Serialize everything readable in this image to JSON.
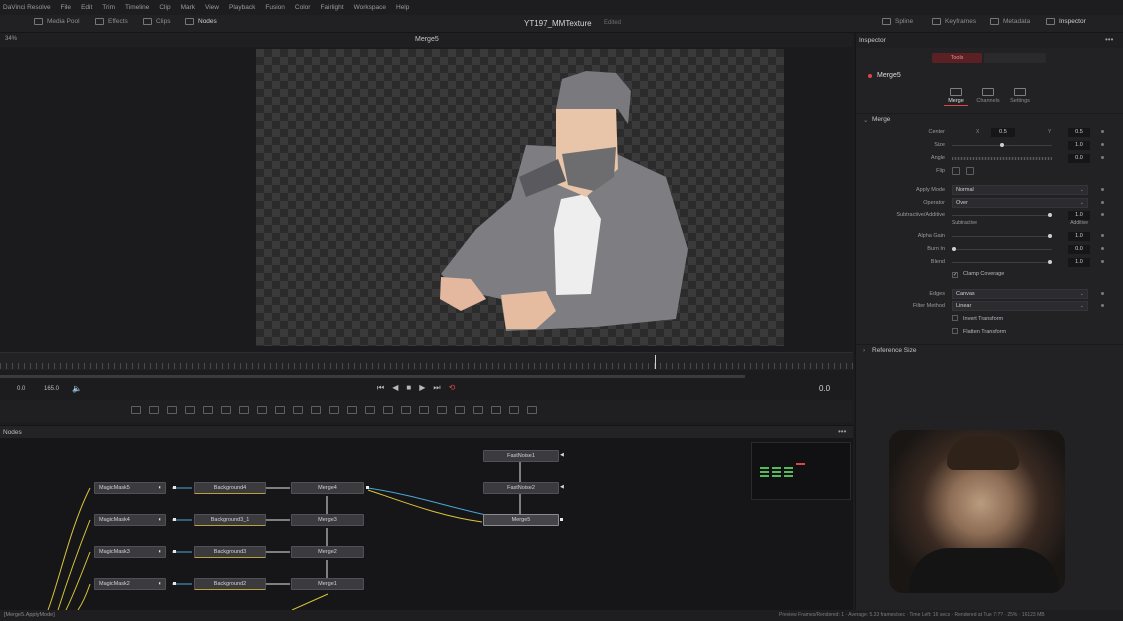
{
  "menu": [
    "DaVinci Resolve",
    "File",
    "Edit",
    "Trim",
    "Timeline",
    "Clip",
    "Mark",
    "View",
    "Playback",
    "Fusion",
    "Color",
    "Fairlight",
    "Workspace",
    "Help"
  ],
  "toolbar": {
    "media_pool": "Media Pool",
    "effects": "Effects",
    "clips": "Clips",
    "nodes": "Nodes",
    "project_title": "YT197_MMTexture",
    "edited": "Edited",
    "spline": "Spline",
    "keyframes": "Keyframes",
    "metadata": "Metadata",
    "inspector": "Inspector"
  },
  "viewer": {
    "zoom": "34%",
    "title": "Merge5"
  },
  "transport": {
    "start": "0.0",
    "end": "165.0",
    "current": "0.0"
  },
  "nodes_panel": {
    "title": "Nodes",
    "menu": "•••",
    "nodes": {
      "magicmask5": "MagicMask5",
      "magicmask4": "MagicMask4",
      "magicmask3": "MagicMask3",
      "magicmask2": "MagicMask2",
      "background4": "Background4",
      "background3_1": "Background3_1",
      "background3": "Background3",
      "background2": "Background2",
      "merge4": "Merge4",
      "merge3": "Merge3",
      "merge2": "Merge2",
      "merge1": "Merge1",
      "fastnoise1": "FastNoise1",
      "fastnoise2": "FastNoise2",
      "merge5": "Merge5"
    }
  },
  "status": {
    "left": "[Merge5.ApplyMode]",
    "right": "Preview Frames/Rendered: 1 · Average: 5.33 frames/sec · Time Left: 16 secs · Rendered at Tue 7:?? · 25% · 16123 MB"
  },
  "inspector": {
    "title": "Inspector",
    "menu": "•••",
    "tool_tab": "Tools",
    "node_name": "Merge5",
    "subtabs": [
      "Merge",
      "Channels",
      "Settings"
    ],
    "section_merge": "Merge",
    "section_reference": "Reference Size",
    "params": {
      "center_label": "Center",
      "center_x_axis": "X",
      "center_x": "0.5",
      "center_y_axis": "Y",
      "center_y": "0.5",
      "size_label": "Size",
      "size": "1.0",
      "angle_label": "Angle",
      "angle": "0.0",
      "flip_label": "Flip",
      "apply_mode_label": "Apply Mode",
      "apply_mode": "Normal",
      "operator_label": "Operator",
      "operator": "Over",
      "subadd_label": "Subtractive/Additive",
      "subadd": "1.0",
      "subtractive": "Subtractive",
      "additive": "Additive",
      "alpha_gain_label": "Alpha Gain",
      "alpha_gain": "1.0",
      "burn_in_label": "Burn In",
      "burn_in": "0.0",
      "blend_label": "Blend",
      "blend": "1.0",
      "clamp_label": "Clamp Coverage",
      "edges_label": "Edges",
      "edges": "Canvas",
      "filter_label": "Filter Method",
      "filter": "Linear",
      "invert_label": "Invert Transform",
      "flatten_label": "Flatten Transform"
    }
  },
  "colors": {
    "accent_red": "#d9454b",
    "node_link_blue": "#4aa8d8",
    "node_link_yellow": "#d9c43a"
  }
}
